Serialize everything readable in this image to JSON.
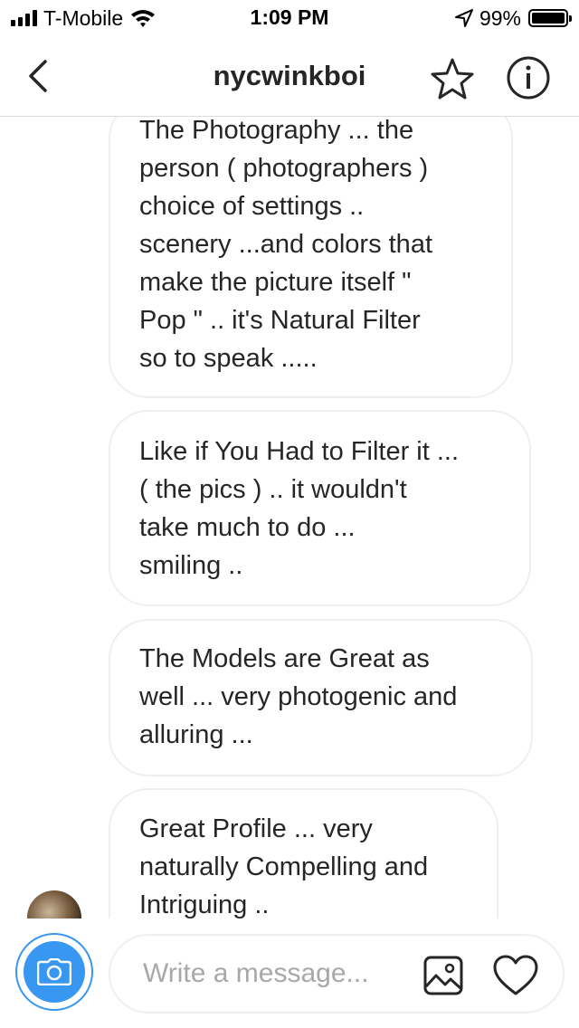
{
  "status_bar": {
    "carrier": "T-Mobile",
    "time": "1:09 PM",
    "battery": "99%",
    "battery_level": 0.99,
    "icons": [
      "signal-icon",
      "wifi-icon",
      "location-arrow-icon",
      "battery-icon"
    ]
  },
  "header": {
    "title": "nycwinkboi",
    "icons": [
      "back-chevron-icon",
      "star-icon",
      "info-icon"
    ]
  },
  "messages": [
    {
      "text": "The Photography ...  the\nperson ( photographers )\nchoice of settings ..\nscenery ...and colors that\nmake the picture itself \"\nPop \"   ..  it's Natural Filter\nso to speak ....."
    },
    {
      "text": "Like if You Had to Filter it ...\n( the pics ) ..  it wouldn't\ntake much to do ...\nsmiling .."
    },
    {
      "text": "The Models are Great as\nwell ... very photogenic and\nalluring ..."
    },
    {
      "text": "Great Profile ...  very\nnaturally Compelling and\nIntriguing .."
    }
  ],
  "composer": {
    "placeholder": "Write a message...",
    "icons": [
      "camera-icon",
      "gallery-icon",
      "heart-icon"
    ]
  },
  "colors": {
    "accent": "#3897f0",
    "text": "#262626",
    "bubble_border": "#efefef",
    "placeholder": "#a8a8a8"
  }
}
